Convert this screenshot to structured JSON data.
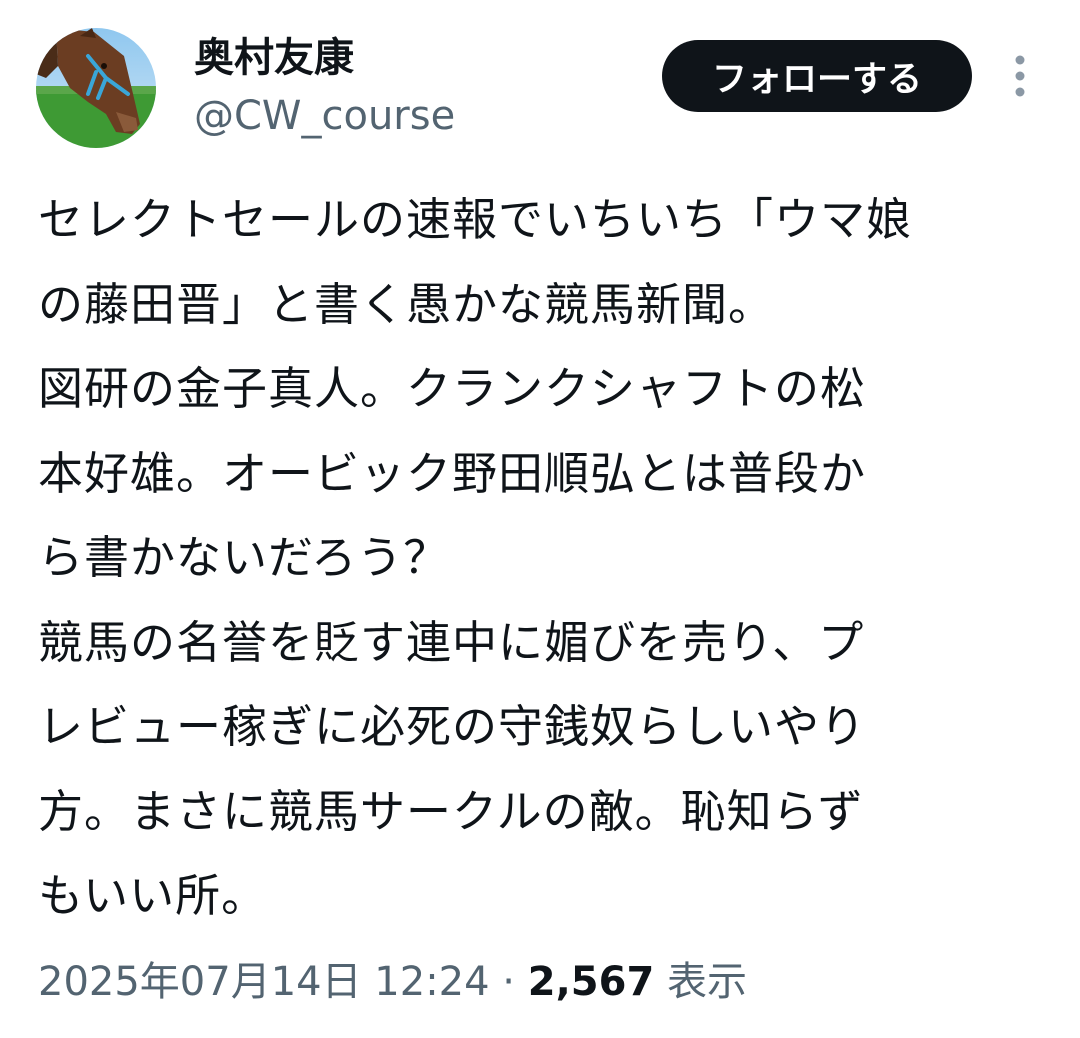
{
  "author": {
    "display_name": "奥村友康",
    "handle": "@CW_course"
  },
  "follow_button": {
    "label": "フォローする"
  },
  "more_icon": "vertical-dots-icon",
  "tweet": {
    "lines": [
      "セレクトセールの速報でいちいち「ウマ娘",
      "の藤田晋」と書く愚かな競馬新聞。",
      "図研の金子真人。クランクシャフトの松",
      "本好雄。オービック野田順弘とは普段か",
      "ら書かないだろう？",
      "競馬の名誉を貶す連中に媚びを売り、プ",
      "レビュー稼ぎに必死の守銭奴らしいやり",
      "方。まさに競馬サークルの敵。恥知らず",
      "もいい所。"
    ]
  },
  "meta": {
    "timestamp": "2025年07月14日 12:24",
    "separator": " · ",
    "views_count": "2,567",
    "views_label": " 表示"
  },
  "colors": {
    "text_primary": "#0f1419",
    "text_secondary": "#536471",
    "button_bg": "#0f1419",
    "button_text": "#ffffff"
  }
}
